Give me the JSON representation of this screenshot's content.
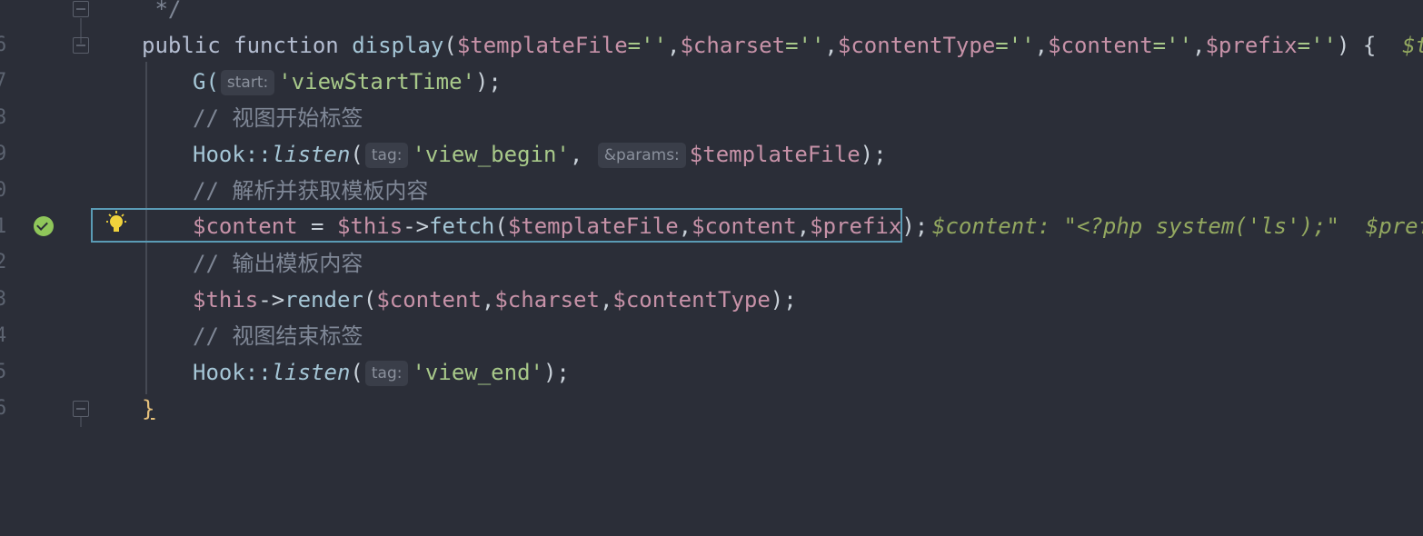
{
  "line_numbers": [
    "6",
    "7",
    "8",
    "9",
    "0",
    "1",
    "2",
    "3",
    "4",
    "5",
    "6"
  ],
  "lines": {
    "l6": {
      "text": " */"
    },
    "l7": {
      "kw_public": "public",
      "kw_function": "function",
      "fn_name": "display",
      "open": "(",
      "p1": "$templateFile",
      "eq1": "=''",
      "c1": ",",
      "p2": "$charset",
      "eq2": "=''",
      "c2": ",",
      "p3": "$contentType",
      "eq3": "=''",
      "c3": ",",
      "p4": "$content",
      "eq4": "=''",
      "c4": ",",
      "p5": "$prefix",
      "eq5": "=''",
      "close": ") {",
      "inlay": "$temp"
    },
    "l8": {
      "fn": "G(",
      "hint": "start:",
      "arg": "'viewStartTime'",
      "end": ");"
    },
    "l9": {
      "comment": "// 视图开始标签"
    },
    "l10": {
      "cls": "Hook::",
      "method": "listen",
      "open": "(",
      "hint1": "tag:",
      "arg1": "'view_begin'",
      "sep": ",",
      "hint2": "&params:",
      "arg2": "$templateFile",
      "end": ");"
    },
    "l11": {
      "comment": "// 解析并获取模板内容"
    },
    "l12": {
      "var1": "$content",
      "eq": " = ",
      "this": "$this",
      "arrow": "->",
      "method": "fetch",
      "open": "(",
      "a1": "$templateFile",
      "s1": ",",
      "a2": "$content",
      "s2": ",",
      "a3": "$prefix",
      "end": ");",
      "inlay": "$content: \"<?php system('ls');\"  $prefi"
    },
    "l13": {
      "comment": "// 输出模板内容"
    },
    "l14": {
      "this": "$this",
      "arrow": "->",
      "method": "render",
      "open": "(",
      "a1": "$content",
      "s1": ",",
      "a2": "$charset",
      "s2": ",",
      "a3": "$contentType",
      "end": ");"
    },
    "l15": {
      "comment": "// 视图结束标签"
    },
    "l16": {
      "cls": "Hook::",
      "method": "listen",
      "open": "(",
      "hint": "tag:",
      "arg": "'view_end'",
      "end": ");"
    },
    "l17": {
      "brace": "}"
    }
  },
  "colors": {
    "background": "#2b2e38",
    "current_line_border": "#5a9bb5",
    "breakpoint_check": "#8fc65a",
    "bulb": "#f0d23c"
  }
}
